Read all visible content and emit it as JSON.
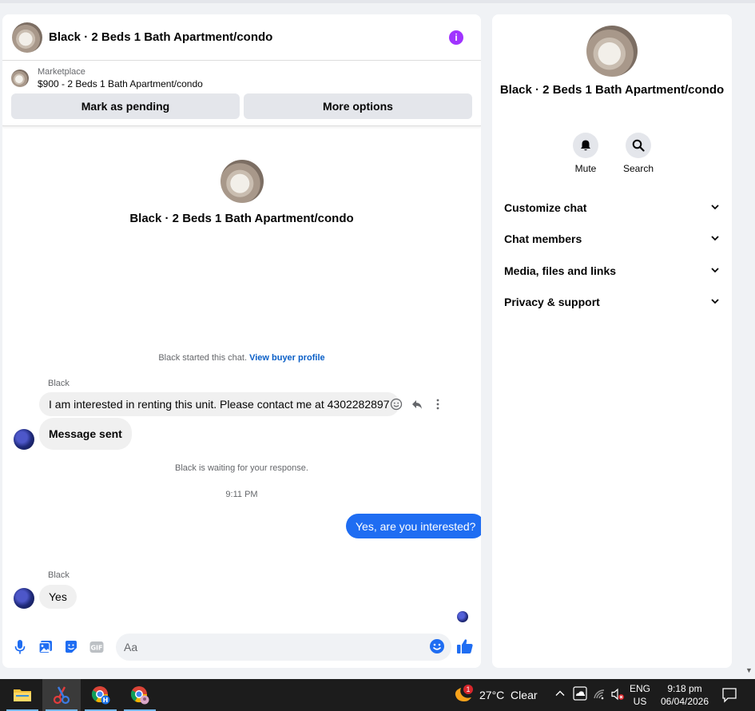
{
  "chat": {
    "title": "Black · 2 Beds 1 Bath Apartment/condo",
    "marketplace_label": "Marketplace",
    "marketplace_item": "$900 - 2 Beds 1 Bath Apartment/condo",
    "mark_pending_label": "Mark as pending",
    "more_options_label": "More options",
    "profile_name": "Black · 2 Beds 1 Bath Apartment/condo",
    "started_text": "Black started this chat.",
    "view_buyer_profile": "View buyer profile",
    "messages": [
      {
        "sender": "Black",
        "text": "I am interested in renting this unit. Please contact me at 4302282897"
      },
      {
        "text": "Message sent"
      },
      {
        "system": "Black is waiting for your response."
      },
      {
        "time": "9:11 PM"
      },
      {
        "outgoing": "Yes, are you interested?"
      },
      {
        "sender": "Black",
        "text": "Yes"
      }
    ],
    "composer_placeholder": "Aa"
  },
  "side": {
    "name": "Black · 2 Beds 1 Bath Apartment/condo",
    "mute_label": "Mute",
    "search_label": "Search",
    "menu": [
      "Customize chat",
      "Chat members",
      "Media, files and links",
      "Privacy & support"
    ]
  },
  "taskbar": {
    "weather": "27°C  Clear",
    "weather_badge": "1",
    "lang_top": "ENG",
    "lang_bottom": "US",
    "time": "9:18 pm",
    "date": "06/04/2026"
  },
  "colors": {
    "accent_blue": "#1f6df2",
    "info_purple": "#a033ff",
    "link_blue": "#0a5fc7"
  },
  "icons": [
    "info-icon",
    "emoji-icon",
    "reply-icon",
    "more-icon",
    "microphone-icon",
    "image-icon",
    "sticker-icon",
    "gif-icon",
    "like-icon",
    "bell-icon",
    "search-icon",
    "chevron-down-icon"
  ]
}
